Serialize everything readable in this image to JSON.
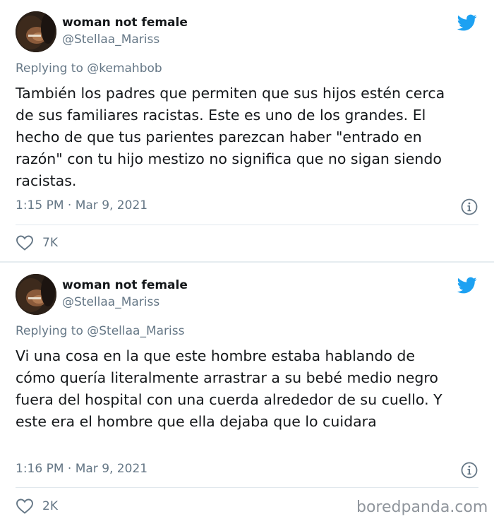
{
  "tweets": [
    {
      "author_name": "woman not female",
      "author_handle": "@Stellaa_Mariss",
      "replying_prefix": "Replying to",
      "replying_to": "@kemahbob",
      "body_lines": [
        "También los padres que permiten que sus hijos estén cerca",
        "de sus familiares racistas. Este es uno de los grandes. El",
        "hecho de que tus parientes parezcan haber \"entrado en",
        "razón\" con tu hijo mestizo no significa que no sigan siendo",
        "racistas."
      ],
      "timestamp": "1:15 PM · Mar 9, 2021",
      "likes": "7K"
    },
    {
      "author_name": "woman not female",
      "author_handle": "@Stellaa_Mariss",
      "replying_prefix": "Replying to",
      "replying_to": "@Stellaa_Mariss",
      "body_lines": [
        "Vi una cosa en la que este hombre estaba hablando de",
        "cómo quería literalmente arrastrar a su bebé medio negro",
        "fuera del hospital con una cuerda alrededor de su cuello. Y",
        "este era el hombre que ella dejaba que lo cuidara"
      ],
      "timestamp": "1:16 PM · Mar 9, 2021",
      "likes": "2K"
    }
  ],
  "watermark": "boredpanda.com",
  "icons": {
    "brand": "twitter-bird-icon",
    "info": "info-icon",
    "like": "heart-icon"
  },
  "colors": {
    "twitter_blue": "#1da1f2",
    "secondary_text": "#657786",
    "primary_text": "#14171a",
    "divider": "#e6ecf0"
  }
}
